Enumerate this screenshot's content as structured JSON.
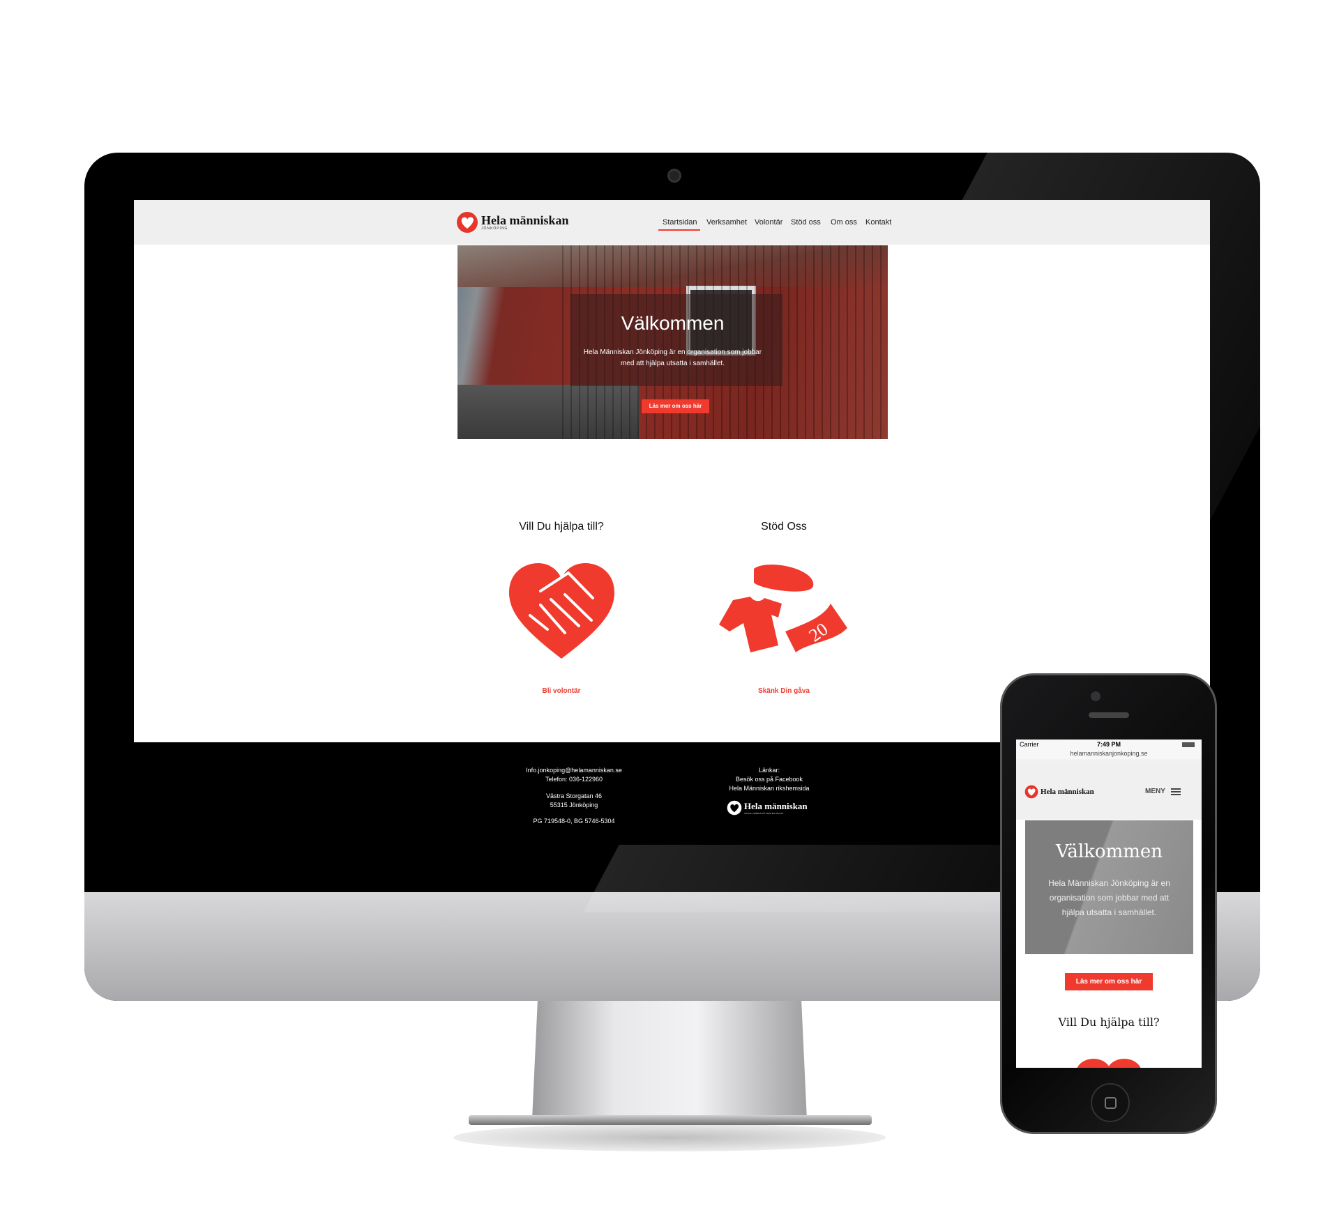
{
  "desktop": {
    "brand": {
      "name": "Hela människan",
      "sub": "JÖNKÖPING"
    },
    "nav": {
      "items": [
        "Startsidan",
        "Verksamhet",
        "Volontär",
        "Stöd oss",
        "Om oss",
        "Kontakt"
      ],
      "active": "Startsidan"
    },
    "hero": {
      "title": "Välkommen",
      "text_line1": "Hela Människan Jönköping är en organisation som jobbar",
      "text_line2": "med att hjälpa utsatta i samhället.",
      "button": "Läs mer om oss här"
    },
    "sections": [
      {
        "title": "Vill Du hjälpa till?",
        "icon": "heart-handshake-icon",
        "link": "Bli volontär"
      },
      {
        "title": "Stöd Oss",
        "icon": "donation-icon",
        "link": "Skänk Din gåva",
        "bill_value": "20"
      }
    ],
    "footer": {
      "email": "Info.jonkoping@helamanniskan.se",
      "phone": "Telefon: 036-122960",
      "street": "Västra Storgatan 46",
      "city": "55315 Jönköping",
      "giro": "PG 719548-0, BG 5746-5304",
      "links_label": "Länkar:",
      "links": [
        "Besök oss på Facebook",
        "Hela Människan rikshemsida"
      ],
      "logo": "Hela människan",
      "logo_sub": "SOCIALT ARBETE PÅ KRISTEN GRUND"
    }
  },
  "mobile": {
    "status": {
      "carrier": "Carrier",
      "time": "7:49 PM"
    },
    "url": "helamanniskanjonkoping.se",
    "brand": "Hela människan",
    "menu_label": "MENY",
    "hero": {
      "title": "Välkommen",
      "text": "Hela Människan Jönköping är en organisation som jobbar med att hjälpa utsatta i samhället."
    },
    "button": "Läs mer om oss här",
    "heading": "Vill Du hjälpa till?"
  },
  "colors": {
    "accent": "#f03a2e",
    "footer_bg": "#000000",
    "nav_bg": "#efefef"
  }
}
